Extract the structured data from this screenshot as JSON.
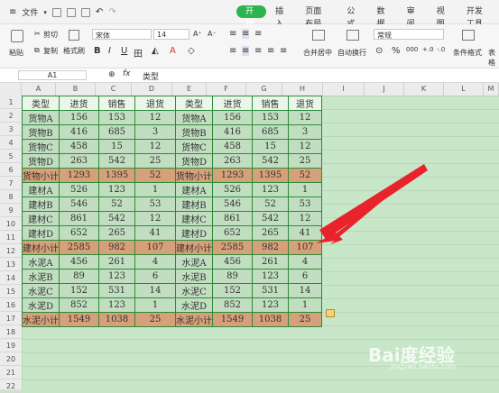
{
  "menubar": {
    "file_label": "文件",
    "tabs": [
      {
        "label": "开始",
        "active": true
      },
      {
        "label": "插入",
        "active": false
      },
      {
        "label": "页面布局",
        "active": false
      },
      {
        "label": "公式",
        "active": false
      },
      {
        "label": "数据",
        "active": false
      },
      {
        "label": "审阅",
        "active": false
      },
      {
        "label": "视图",
        "active": false
      },
      {
        "label": "开发工具",
        "active": false
      }
    ]
  },
  "ribbon": {
    "paste_label": "粘贴",
    "cut_label": "剪切",
    "copy_label": "复制",
    "format_painter_label": "格式刷",
    "font_name": "宋体",
    "font_size": "14",
    "bold": "B",
    "italic": "I",
    "underline": "U",
    "merge_center_label": "合并居中",
    "wrap_label": "自动换行",
    "number_format": "常规",
    "percent": "%",
    "thousands": "000",
    "conditional_format_label": "条件格式",
    "table_style_label": "表格"
  },
  "formula_bar": {
    "cell_ref": "A1",
    "fx": "fx",
    "value": "类型"
  },
  "columns": [
    "A",
    "B",
    "C",
    "D",
    "E",
    "F",
    "G",
    "H",
    "I",
    "J",
    "K",
    "L",
    "M"
  ],
  "rows": [
    "1",
    "2",
    "3",
    "4",
    "5",
    "6",
    "7",
    "8",
    "9",
    "10",
    "11",
    "12",
    "13",
    "14",
    "15",
    "16",
    "17",
    "18",
    "19",
    "20",
    "21",
    "22"
  ],
  "table": {
    "header": [
      "类型",
      "进货",
      "销售",
      "退货",
      "类型",
      "进货",
      "销售",
      "退货"
    ],
    "rows": [
      {
        "kind": "norm",
        "cells": [
          "货物A",
          "156",
          "153",
          "12",
          "货物A",
          "156",
          "153",
          "12"
        ]
      },
      {
        "kind": "norm",
        "cells": [
          "货物B",
          "416",
          "685",
          "3",
          "货物B",
          "416",
          "685",
          "3"
        ]
      },
      {
        "kind": "norm",
        "cells": [
          "货物C",
          "458",
          "15",
          "12",
          "货物C",
          "458",
          "15",
          "12"
        ]
      },
      {
        "kind": "norm",
        "cells": [
          "货物D",
          "263",
          "542",
          "25",
          "货物D",
          "263",
          "542",
          "25"
        ]
      },
      {
        "kind": "sub",
        "cells": [
          "货物小计",
          "1293",
          "1395",
          "52",
          "货物小计",
          "1293",
          "1395",
          "52"
        ]
      },
      {
        "kind": "norm",
        "cells": [
          "建材A",
          "526",
          "123",
          "1",
          "建材A",
          "526",
          "123",
          "1"
        ]
      },
      {
        "kind": "norm",
        "cells": [
          "建材B",
          "546",
          "52",
          "53",
          "建材B",
          "546",
          "52",
          "53"
        ]
      },
      {
        "kind": "norm",
        "cells": [
          "建材C",
          "861",
          "542",
          "12",
          "建材C",
          "861",
          "542",
          "12"
        ]
      },
      {
        "kind": "norm",
        "cells": [
          "建材D",
          "652",
          "265",
          "41",
          "建材D",
          "652",
          "265",
          "41"
        ]
      },
      {
        "kind": "sub",
        "cells": [
          "建材小计",
          "2585",
          "982",
          "107",
          "建材小计",
          "2585",
          "982",
          "107"
        ]
      },
      {
        "kind": "norm",
        "cells": [
          "水泥A",
          "456",
          "261",
          "4",
          "水泥A",
          "456",
          "261",
          "4"
        ]
      },
      {
        "kind": "norm",
        "cells": [
          "水泥B",
          "89",
          "123",
          "6",
          "水泥B",
          "89",
          "123",
          "6"
        ]
      },
      {
        "kind": "norm",
        "cells": [
          "水泥C",
          "152",
          "531",
          "14",
          "水泥C",
          "152",
          "531",
          "14"
        ]
      },
      {
        "kind": "norm",
        "cells": [
          "水泥D",
          "852",
          "123",
          "1",
          "水泥D",
          "852",
          "123",
          "1"
        ]
      },
      {
        "kind": "sub",
        "cells": [
          "水泥小计",
          "1549",
          "1038",
          "25",
          "水泥小计",
          "1549",
          "1038",
          "25"
        ]
      }
    ]
  },
  "watermark": "Bai度经验",
  "watermark_sub": "jingyan.baidu.com"
}
